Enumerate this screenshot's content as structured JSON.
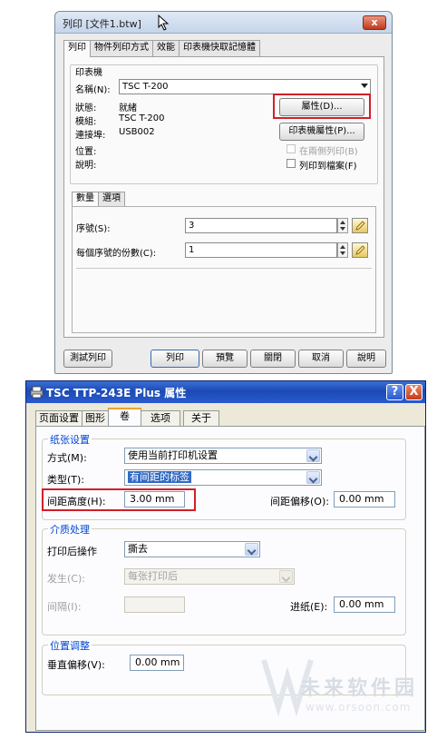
{
  "print_dialog": {
    "title": "列印 [文件1.btw]",
    "tabs": [
      "列印",
      "物件列印方式",
      "效能",
      "印表機快取記憶體"
    ],
    "printer_group": "印表機",
    "name_label": "名稱(N):",
    "printer_name": "TSC T-200",
    "status_label": "狀態:",
    "status_value": "就緒",
    "model_label": "模組:",
    "model_value": "TSC T-200",
    "port_label": "連接埠:",
    "port_value": "USB002",
    "location_label": "位置:",
    "comment_label": "說明:",
    "properties_button": "屬性(D)...",
    "printer_properties_button": "印表機屬性(P)...",
    "duplex_label": "在兩側列印(B)",
    "print_to_file_label": "列印到檔案(F)",
    "sub_tabs": [
      "數量",
      "選項"
    ],
    "serial_label": "序號(S):",
    "serial_value": "3",
    "copies_label": "每個序號的份數(C):",
    "copies_value": "1",
    "buttons": {
      "test": "測試列印",
      "print": "列印",
      "preview": "預覽",
      "close": "關閉",
      "cancel": "取消",
      "help": "說明"
    },
    "close_glyph": "x"
  },
  "props_dialog": {
    "title": "TSC TTP-243E Plus 属性",
    "help_glyph": "?",
    "close_glyph": "X",
    "tabs": [
      "页面设置",
      "图形",
      "卷",
      "选项",
      "关于"
    ],
    "paper_group": "纸张设置",
    "method_label": "方式(M):",
    "method_value": "使用当前打印机设置",
    "type_label": "类型(T):",
    "type_value": "有间距的标签",
    "gap_height_label": "间距高度(H):",
    "gap_height_value": "3.00 mm",
    "gap_offset_label": "间距偏移(O):",
    "gap_offset_value": "0.00 mm",
    "media_group": "介质处理",
    "post_print_label": "打印后操作",
    "post_print_value": "撕去",
    "occur_label": "发生(C):",
    "occur_value": "每张打印后",
    "interval_label": "间隔(I):",
    "interval_value": "",
    "feed_label": "进纸(E):",
    "feed_value": "0.00 mm",
    "position_group": "位置调整",
    "vertical_offset_label": "垂直偏移(V):",
    "vertical_offset_value": "0.00 mm"
  },
  "watermark": {
    "text": "未来软件园",
    "url": "www.orsoon.com"
  },
  "colors": {
    "highlight_box": "#d0202a",
    "xp_title": "#1c4ab4",
    "group_title": "#0046d5",
    "selection": "#316ac5"
  }
}
